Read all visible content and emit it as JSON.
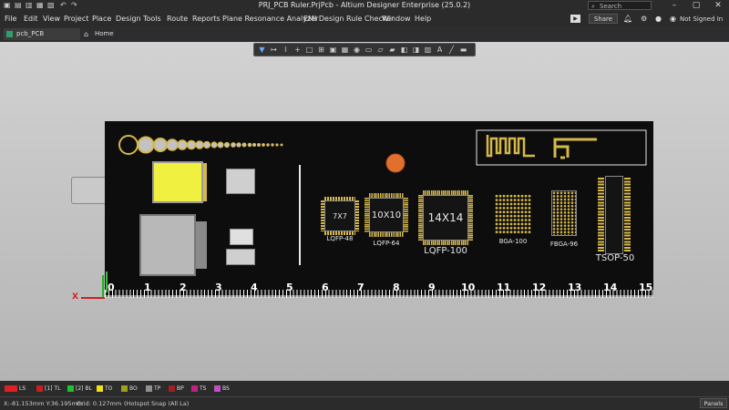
{
  "window": {
    "title": "PRJ_PCB Ruler.PrjPcb - Altium Designer Enterprise (25.0.2)"
  },
  "search": {
    "placeholder": "Search"
  },
  "menu": [
    "File",
    "Edit",
    "View",
    "Project",
    "Place",
    "Design",
    "Tools",
    "Route",
    "Reports",
    "Plane Resonance Analyzer",
    "EMI Design Rule Checker",
    "Window",
    "Help"
  ],
  "right_header": {
    "share": "Share",
    "user": "Not Signed In"
  },
  "tabs": [
    {
      "label": "pcb_PCB Ruler.PcbDoc"
    },
    {
      "label": "Home Page"
    }
  ],
  "packages": {
    "lqfp48": {
      "body": "7X7",
      "name": "LQFP-48"
    },
    "lqfp64": {
      "body": "10X10",
      "name": "LQFP-64"
    },
    "lqfp100": {
      "body": "14X14",
      "name": "LQFP-100"
    },
    "bga100": {
      "name": "BGA-100"
    },
    "fbga96": {
      "name": "FBGA-96"
    },
    "tsop50": {
      "name": "TSOP-50"
    }
  },
  "ruler": {
    "numbers": [
      "0",
      "1",
      "2",
      "3",
      "4",
      "5",
      "6",
      "7",
      "8",
      "9",
      "10",
      "11",
      "12",
      "13",
      "14",
      "15"
    ]
  },
  "layers": [
    {
      "label": "LS",
      "color": "#e02020"
    },
    {
      "label": "[1] TL",
      "color": "#c81e1e"
    },
    {
      "label": "[2] BL",
      "color": "#20c030"
    },
    {
      "label": "TO",
      "color": "#f0e020"
    },
    {
      "label": "BO",
      "color": "#a0a020"
    },
    {
      "label": "TP",
      "color": "#909090"
    },
    {
      "label": "BP",
      "color": "#a02020"
    },
    {
      "label": "TS",
      "color": "#c02080"
    },
    {
      "label": "BS",
      "color": "#c050c0"
    }
  ],
  "status": {
    "coords": "X:-81.153mm Y:36.195mm",
    "grid": "Grid: 0.127mm",
    "snap": "(Hotspot Snap (All La)",
    "panels": "Panels"
  },
  "colors": {
    "accent": "#d6b84a",
    "board": "#0d0d0d"
  }
}
